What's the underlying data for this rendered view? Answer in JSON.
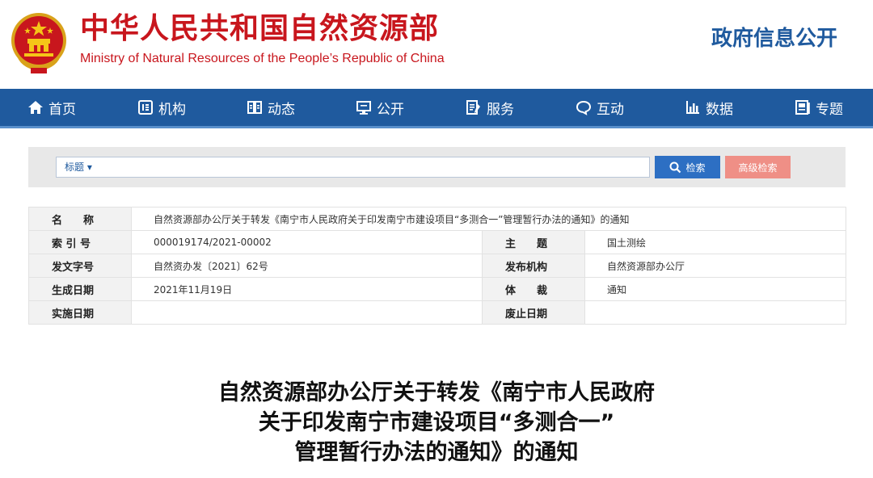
{
  "header": {
    "title_cn": "中华人民共和国自然资源部",
    "title_en": "Ministry of Natural Resources of the People’s Republic of China",
    "gov_info_open": "政府信息公开",
    "brand_color": "#c8161d",
    "accent_color": "#1f5a9e"
  },
  "nav": {
    "items": [
      {
        "label": "首页",
        "icon": "home-icon"
      },
      {
        "label": "机构",
        "icon": "org-icon"
      },
      {
        "label": "动态",
        "icon": "book-icon"
      },
      {
        "label": "公开",
        "icon": "monitor-icon"
      },
      {
        "label": "服务",
        "icon": "document-edit-icon"
      },
      {
        "label": "互动",
        "icon": "chat-icon"
      },
      {
        "label": "数据",
        "icon": "bar-chart-icon"
      },
      {
        "label": "专题",
        "icon": "topic-icon"
      }
    ]
  },
  "search": {
    "category": "标题 ▾",
    "placeholder": "",
    "search_label": "检索",
    "advanced_label": "高级检索"
  },
  "info": {
    "name_label": "名　　称",
    "name_value": "自然资源部办公厅关于转发《南宁市人民政府关于印发南宁市建设项目“多测合一”管理暂行办法的通知》的通知",
    "index_label": "索 引 号",
    "index_value": "000019174/2021-00002",
    "subject_label": "主　　题",
    "subject_value": "国土测绘",
    "docno_label": "发文字号",
    "docno_value": "自然资办发〔2021〕62号",
    "issuer_label": "发布机构",
    "issuer_value": "自然资源部办公厅",
    "date_label": "生成日期",
    "date_value": "2021年11月19日",
    "genre_label": "体　　裁",
    "genre_value": "通知",
    "effective_label": "实施日期",
    "effective_value": "",
    "abolish_label": "废止日期",
    "abolish_value": ""
  },
  "doc": {
    "title_line1": "自然资源部办公厅关于转发《南宁市人民政府",
    "title_line2": "关于印发南宁市建设项目“多测合一”",
    "title_line3": "管理暂行办法的通知》的通知"
  }
}
